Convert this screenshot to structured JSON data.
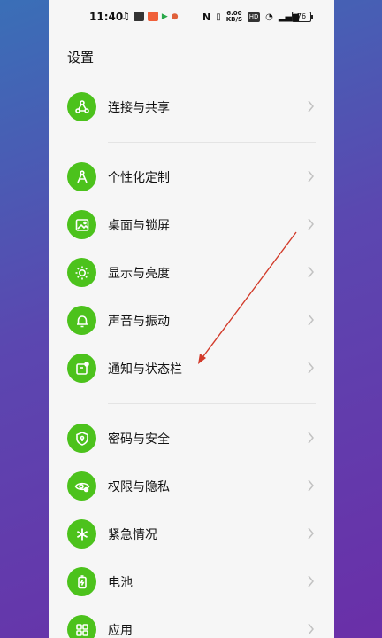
{
  "status_bar": {
    "time": "11:40",
    "hd_label": "HD",
    "speed": "6.00",
    "speed_unit": "KB/S",
    "battery": "76"
  },
  "header": {
    "title": "设置"
  },
  "groups": [
    {
      "items": [
        {
          "label": "连接与共享",
          "icon": "share-icon"
        }
      ]
    },
    {
      "items": [
        {
          "label": "个性化定制",
          "icon": "compass-icon"
        },
        {
          "label": "桌面与锁屏",
          "icon": "image-icon"
        },
        {
          "label": "显示与亮度",
          "icon": "sun-icon"
        },
        {
          "label": "声音与振动",
          "icon": "bell-icon"
        },
        {
          "label": "通知与状态栏",
          "icon": "notification-icon"
        }
      ]
    },
    {
      "items": [
        {
          "label": "密码与安全",
          "icon": "shield-icon"
        },
        {
          "label": "权限与隐私",
          "icon": "privacy-eye-icon"
        },
        {
          "label": "紧急情况",
          "icon": "emergency-icon"
        },
        {
          "label": "电池",
          "icon": "battery-icon"
        },
        {
          "label": "应用",
          "icon": "apps-grid-icon"
        }
      ]
    }
  ],
  "colors": {
    "accent": "#4cc21c",
    "annotation_arrow": "#d23a2a"
  }
}
